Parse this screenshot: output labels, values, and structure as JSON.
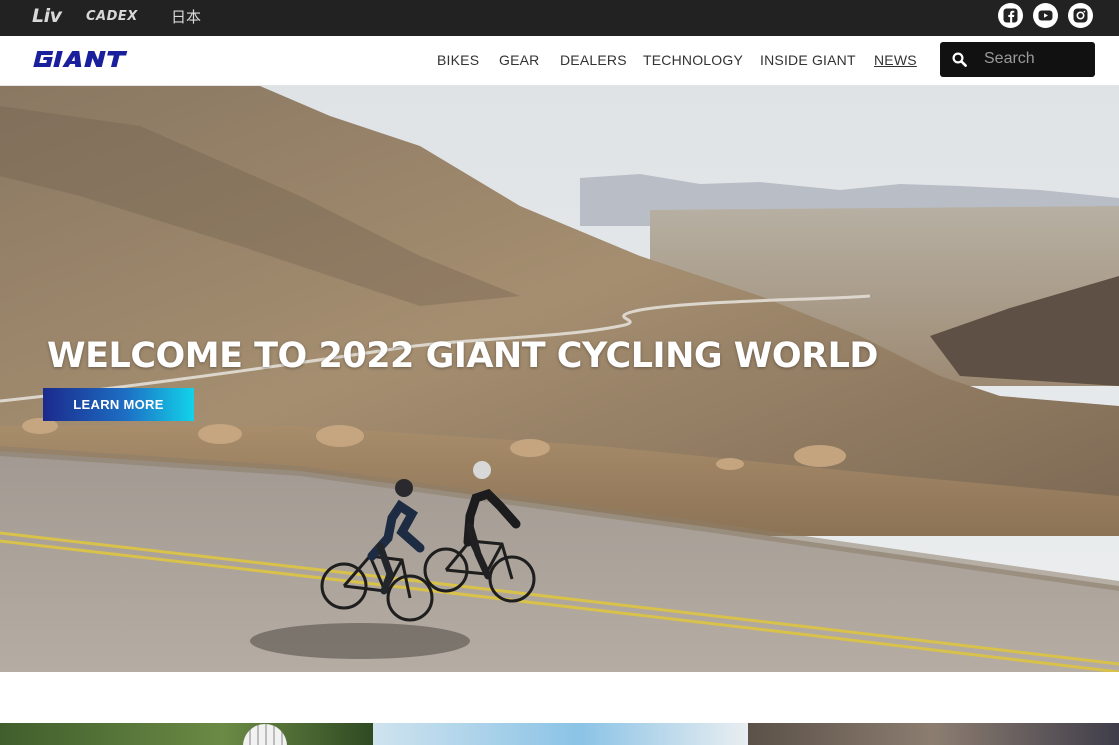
{
  "topbar": {
    "brands": [
      {
        "label": "Liv"
      },
      {
        "label": "CADEX"
      },
      {
        "label": "日本"
      }
    ],
    "social": [
      {
        "icon": "facebook-icon"
      },
      {
        "icon": "youtube-icon"
      },
      {
        "icon": "instagram-icon"
      }
    ]
  },
  "header": {
    "logo": "GIANT",
    "nav": [
      {
        "label": "BIKES"
      },
      {
        "label": "GEAR"
      },
      {
        "label": "DEALERS"
      },
      {
        "label": "TECHNOLOGY"
      },
      {
        "label": "INSIDE GIANT"
      },
      {
        "label": "NEWS",
        "active": true
      }
    ],
    "search": {
      "placeholder": "Search",
      "value": "",
      "icon": "search-icon"
    }
  },
  "hero": {
    "title": "WELCOME TO 2022 GIANT CYCLING WORLD",
    "cta_label": "LEARN MORE",
    "image_subject": "two cyclists on a desert mountain road"
  },
  "colors": {
    "topbar_bg": "#222222",
    "brand_blue": "#1a1f9c",
    "cta_gradient_start": "#1b2a8c",
    "cta_gradient_end": "#12d3ea"
  }
}
